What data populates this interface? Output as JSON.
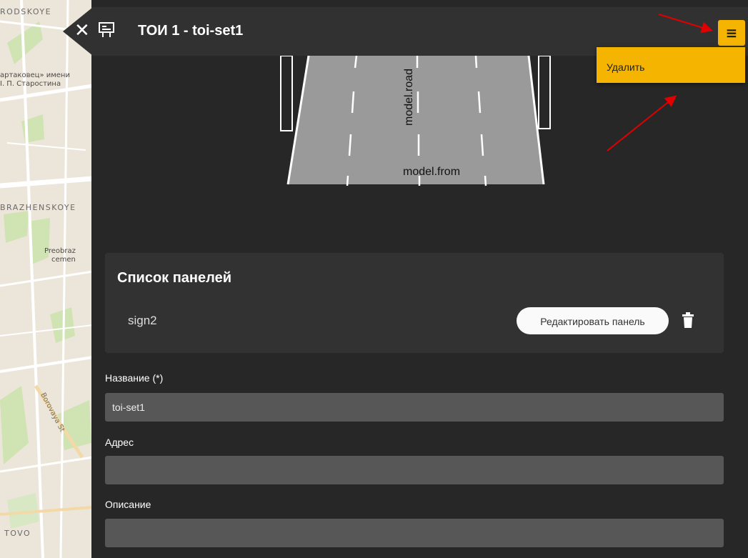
{
  "map": {
    "district_top": "RODSKOYE",
    "poi_1_line1": "артаковец» имени",
    "poi_1_line2": "І. П. Старостина",
    "district_mid": "BRAZHENSKOYE",
    "poi_2_line1": "Preobraz",
    "poi_2_line2": "cemen",
    "street": "Borovaya St",
    "district_bottom": "TOVO"
  },
  "header": {
    "close_icon": "close-icon",
    "sign_icon": "road-sign-icon",
    "title": "ТОИ 1 - toi-set1",
    "menu_icon": "hamburger-menu-icon"
  },
  "dropdown": {
    "items": [
      {
        "label": "Удалить"
      }
    ]
  },
  "preview": {
    "road_label": "model.road",
    "from_label": "model.from"
  },
  "panels": {
    "title": "Список панелей",
    "rows": [
      {
        "name": "sign2",
        "edit_label": "Редактировать панель",
        "delete_icon": "trash-icon"
      }
    ]
  },
  "form": {
    "name_label": "Название (*)",
    "name_value": "toi-set1",
    "address_label": "Адрес",
    "address_value": "",
    "description_label": "Описание",
    "description_value": ""
  },
  "colors": {
    "accent": "#f5b400",
    "panel_bg": "#272727",
    "header_bg": "#313131",
    "input_bg": "#575757",
    "annotation_arrow": "#e00000"
  }
}
